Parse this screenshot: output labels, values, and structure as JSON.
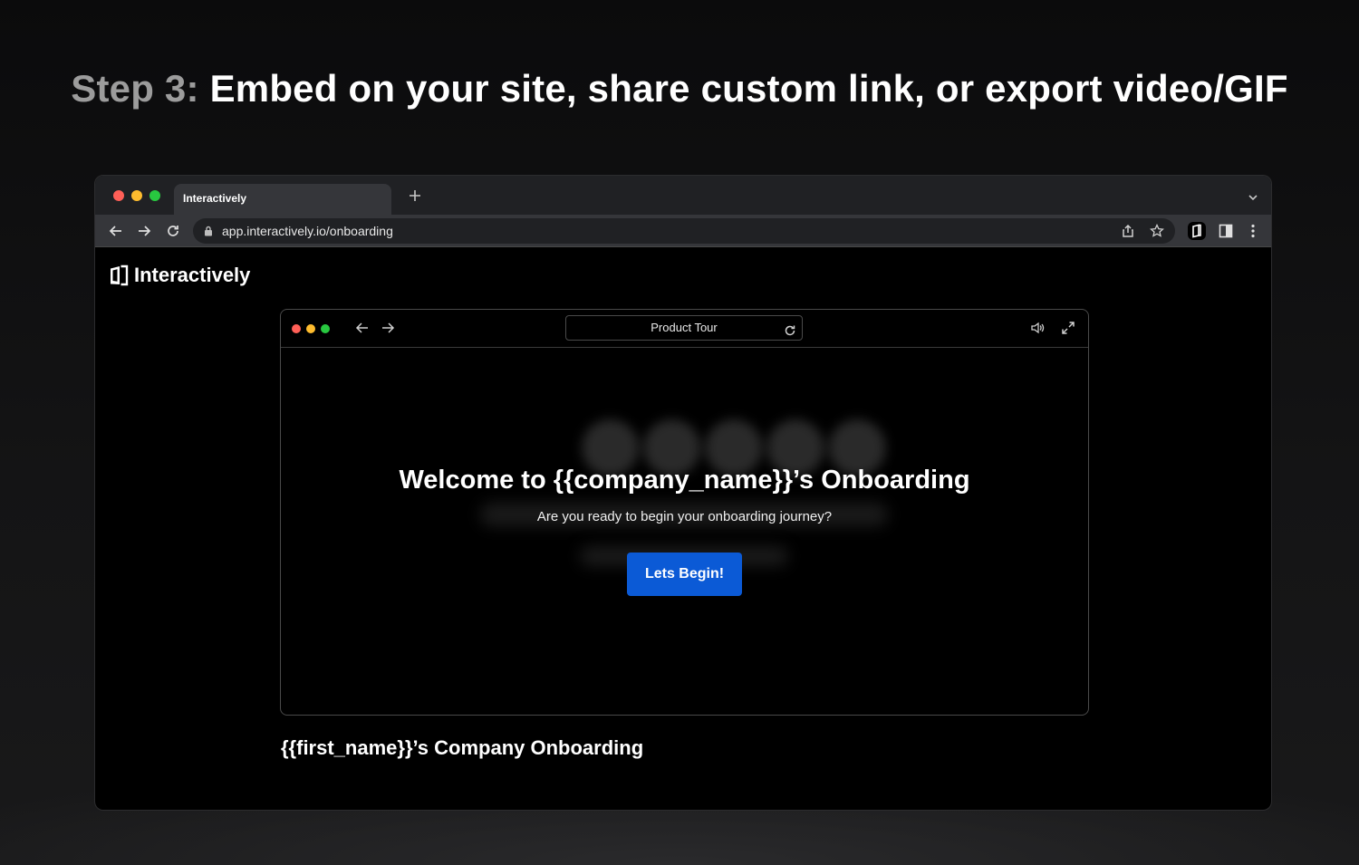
{
  "headline": {
    "step": "Step 3:",
    "text": "Embed on your site, share custom link, or export video/GIF"
  },
  "browser": {
    "traffic_lights": [
      "#ff5f57",
      "#febc2e",
      "#28c840"
    ],
    "tab_title": "Interactively",
    "new_tab_icon": "plus-icon",
    "url": "app.interactively.io/onboarding"
  },
  "page": {
    "brand_name": "Interactively",
    "embed": {
      "title": "Product Tour",
      "traffic_lights": [
        "#ff5f57",
        "#febc2e",
        "#28c840"
      ],
      "welcome_title": "Welcome to {{company_name}}’s Onboarding",
      "subtitle": "Are you ready to begin your onboarding journey?",
      "cta_label": "Lets Begin!",
      "cta_color": "#0b5ad6"
    },
    "caption": "{{first_name}}’s Company Onboarding"
  }
}
